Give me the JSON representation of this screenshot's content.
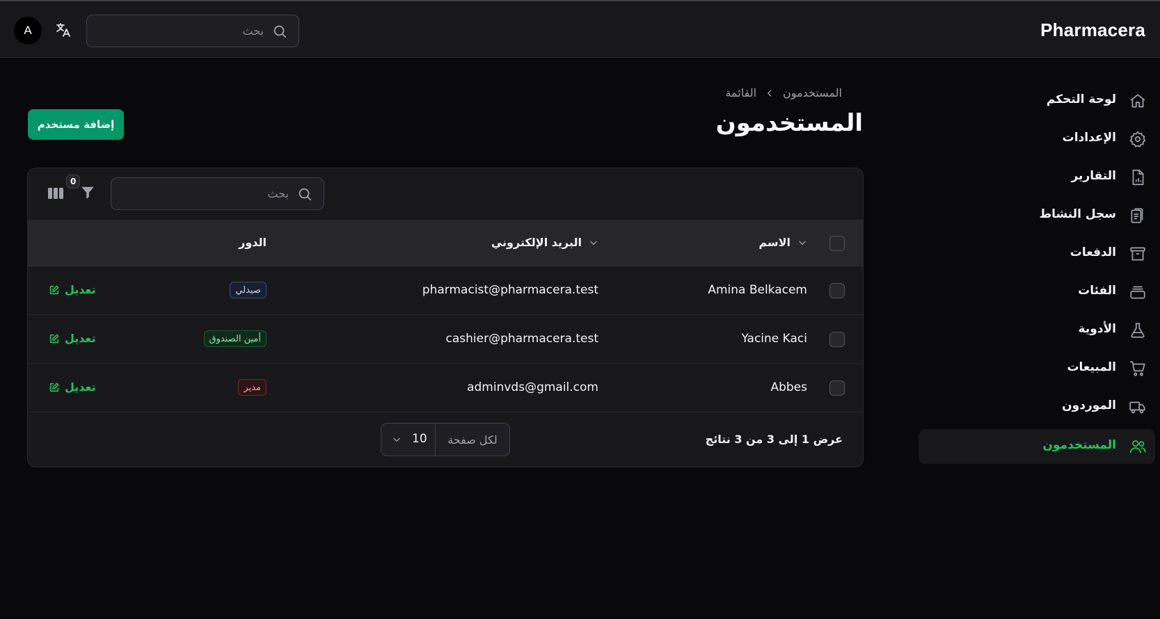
{
  "topbar": {
    "brand": "Pharmacera",
    "search_placeholder": "بحث",
    "avatar_initial": "A"
  },
  "sidebar": {
    "items": [
      {
        "label": "لوحة التحكم",
        "icon": "home-icon",
        "active": false
      },
      {
        "label": "الإعدادات",
        "icon": "gear-icon",
        "active": false
      },
      {
        "label": "التقارير",
        "icon": "report-icon",
        "active": false
      },
      {
        "label": "سجل النشاط",
        "icon": "clipboard-icon",
        "active": false
      },
      {
        "label": "الدفعات",
        "icon": "archive-box-icon",
        "active": false
      },
      {
        "label": "الفئات",
        "icon": "stack-icon",
        "active": false
      },
      {
        "label": "الأدوية",
        "icon": "flask-icon",
        "active": false
      },
      {
        "label": "المبيعات",
        "icon": "cart-icon",
        "active": false
      },
      {
        "label": "الموردون",
        "icon": "truck-icon",
        "active": false
      },
      {
        "label": "المستخدمون",
        "icon": "users-icon",
        "active": true
      }
    ],
    "active_color": "#22c55e"
  },
  "page": {
    "breadcrumb": [
      "المستخدمون",
      "القائمة"
    ],
    "title": "المستخدمون",
    "add_button": "إضافة مستخدم"
  },
  "table": {
    "search_placeholder": "بحث",
    "filter_count": "0",
    "columns": {
      "name": "الاسم",
      "email": "البريد الإلكتروني",
      "role": "الدور"
    },
    "rows": [
      {
        "name": "Amina Belkacem",
        "email": "pharmacist@pharmacera.test",
        "role": "صيدلي",
        "role_type": "pharmacist",
        "action": "تعديل"
      },
      {
        "name": "Yacine Kaci",
        "email": "cashier@pharmacera.test",
        "role": "أمين الصندوق",
        "role_type": "cashier",
        "action": "تعديل"
      },
      {
        "name": "Abbes",
        "email": "adminvds@gmail.com",
        "role": "مدير",
        "role_type": "admin",
        "action": "تعديل"
      }
    ],
    "footer": {
      "results_text": "عرض 1 إلى 3 من 3 نتائج",
      "per_page_label": "لكل صفحة",
      "per_page_value": "10"
    }
  },
  "colors": {
    "background": "#09090b",
    "surface": "#18181b",
    "accent": "#059669",
    "link": "#22c55e"
  }
}
